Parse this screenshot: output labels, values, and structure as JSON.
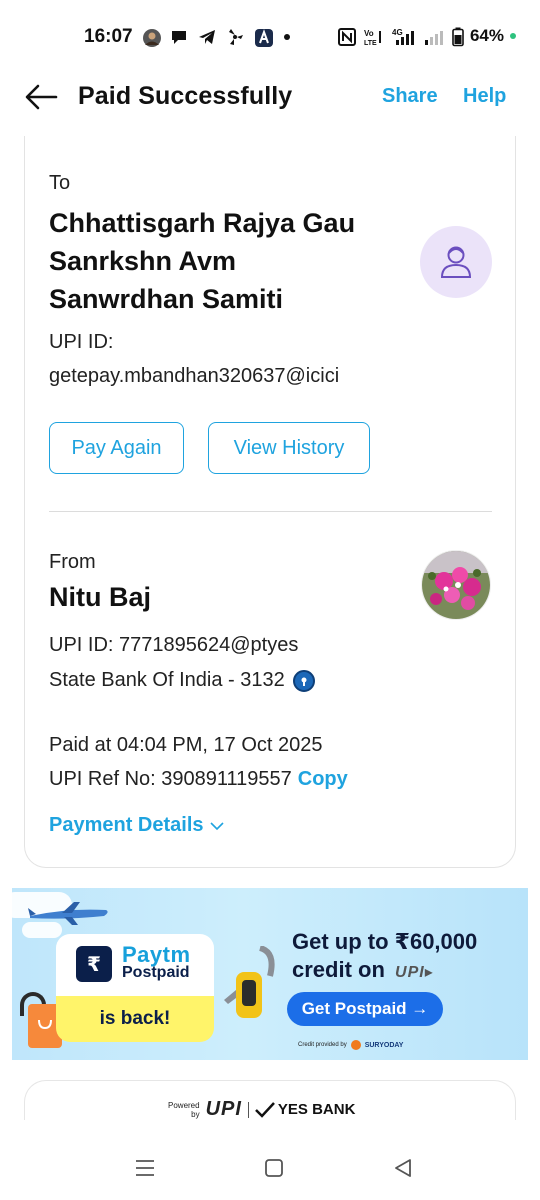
{
  "status_bar": {
    "time": "16:07",
    "network_label": "4G",
    "battery_percent": "64%",
    "left_icons": [
      "profile-avatar-icon",
      "chat-bubble-icon",
      "telegram-icon",
      "fan-icon",
      "app-a-icon",
      "dot-icon"
    ],
    "right_icons": [
      "nfc-icon",
      "volte-icon",
      "signal-4g-icon",
      "signal-weak-icon",
      "battery-icon"
    ],
    "accent_green": "#2ec27e"
  },
  "header": {
    "title": "Paid Successfully",
    "share_label": "Share",
    "help_label": "Help",
    "link_color": "#1fa3df"
  },
  "payee": {
    "to_label": "To",
    "name": "Chhattisgarh Rajya Gau Sanrkshn Avm Sanwrdhan Samiti",
    "upi_label": "UPI ID:",
    "upi_id": "getepay.mbandhan320637@icici",
    "pay_again_label": "Pay Again",
    "view_history_label": "View History"
  },
  "payer": {
    "from_label": "From",
    "name": "Nitu Baj",
    "upi_line": "UPI ID: 7771895624@ptyes",
    "bank_line": "State Bank Of India - 3132"
  },
  "transaction": {
    "paid_at": "Paid at 04:04 PM, 17 Oct 2025",
    "ref_line": "UPI Ref No: 390891119557",
    "copy_label": "Copy",
    "payment_details_label": "Payment Details"
  },
  "banner": {
    "brand": "Paytm",
    "product": "Postpaid",
    "tagline": "is back!",
    "headline_line1": "Get up to ₹60,000",
    "headline_line2": "credit on",
    "cta_label": "Get Postpaid →",
    "credit_provided_by": "Credit provided by",
    "partner": "SURYODAY"
  },
  "footer": {
    "powered_by_line1": "Powered",
    "powered_by_line2": "by",
    "upi_mark": "UPI",
    "bank": "YES BANK"
  },
  "navbar": {
    "items": [
      "menu-icon",
      "home-square-icon",
      "back-triangle-icon"
    ]
  }
}
